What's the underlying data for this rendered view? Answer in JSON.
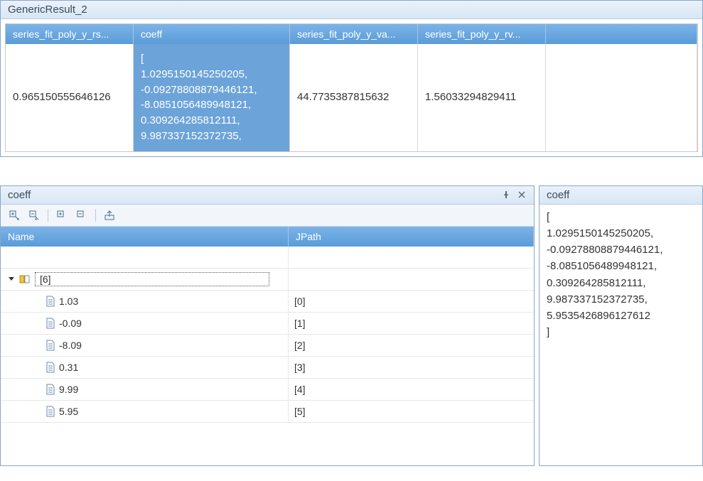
{
  "top": {
    "title": "GenericResult_2",
    "columns": [
      "series_fit_poly_y_rs...",
      "coeff",
      "series_fit_poly_y_va...",
      "series_fit_poly_y_rv..."
    ],
    "row": {
      "rsquare": "0.965150555646126",
      "coeff_display": "[\n  1.0295150145250205,\n  -0.09278808879446121,\n  -8.0851056489948121,\n  0.309264285812111,\n  9.987337152372735,",
      "variance": "44.7735387815632",
      "rvariance": "1.56033294829411"
    }
  },
  "tree": {
    "title": "coeff",
    "headers": {
      "name": "Name",
      "jpath": "JPath"
    },
    "root_label": "[6]",
    "items": [
      {
        "value": "1.03",
        "jpath": "[0]"
      },
      {
        "value": "-0.09",
        "jpath": "[1]"
      },
      {
        "value": "-8.09",
        "jpath": "[2]"
      },
      {
        "value": "0.31",
        "jpath": "[3]"
      },
      {
        "value": "9.99",
        "jpath": "[4]"
      },
      {
        "value": "5.95",
        "jpath": "[5]"
      }
    ]
  },
  "detail": {
    "title": "coeff",
    "body": "[\n  1.0295150145250205,\n  -0.09278808879446121,\n  -8.0851056489948121,\n  0.309264285812111,\n  9.987337152372735,\n  5.9535426896127612\n]"
  }
}
